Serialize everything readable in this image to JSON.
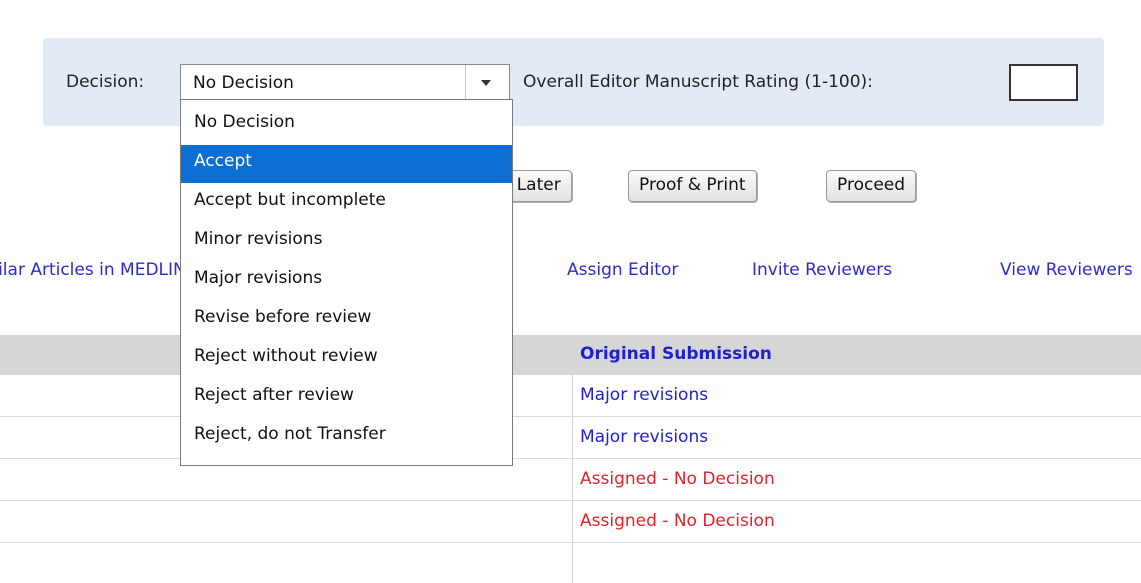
{
  "decision": {
    "label": "Decision:",
    "selected": "No Decision",
    "options": [
      "No Decision",
      "Accept",
      "Accept but incomplete",
      "Minor revisions",
      "Major revisions",
      "Revise before review",
      "Reject without review",
      "Reject after review",
      "Reject, do not Transfer"
    ],
    "highlighted": "Accept"
  },
  "rating": {
    "label": "Overall Editor Manuscript Rating (1-100):",
    "value": ""
  },
  "buttons": {
    "submit_later": "Submit Later",
    "proof_print": "Proof & Print",
    "proceed": "Proceed"
  },
  "links": {
    "similar_articles": "Similar Articles in MEDLINE",
    "assign_editor": "Assign Editor",
    "invite_reviewers": "Invite Reviewers",
    "view_reviewers": "View Reviewers"
  },
  "table": {
    "column_header": "Original Submission",
    "rows": [
      {
        "status": "Major revisions"
      },
      {
        "status": "Major revisions"
      },
      {
        "status": "Assigned - No Decision"
      },
      {
        "status": "Assigned - No Decision"
      },
      {
        "status": ""
      }
    ]
  },
  "colors": {
    "link_blue": "#1f1fd0",
    "status_red": "#e0232b",
    "panel_bg": "#e2ebf5",
    "highlight": "#0b6fd3"
  }
}
